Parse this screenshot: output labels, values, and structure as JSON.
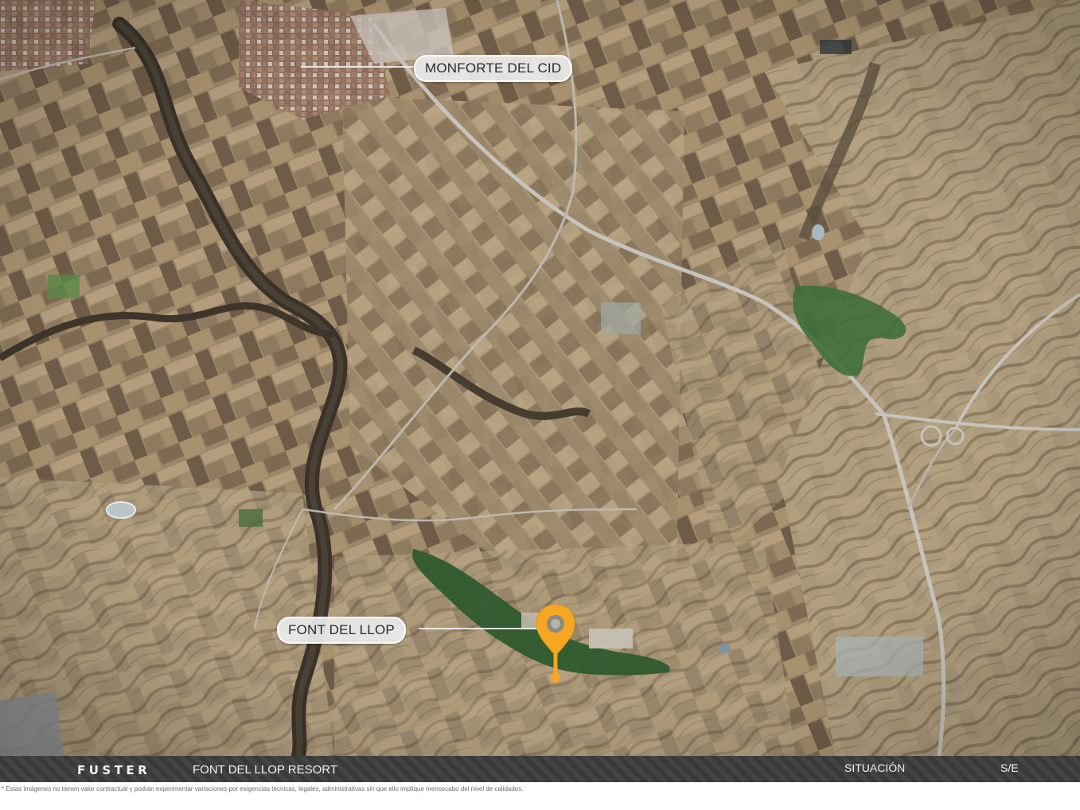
{
  "map": {
    "labels": {
      "monforte": "MONFORTE DEL CID",
      "font_del_llop": "FONT DEL LLOP"
    },
    "marker": {
      "icon": "location-pin-icon",
      "color": "#f5a623"
    }
  },
  "footer": {
    "brand": "FUSTER",
    "project": "FONT DEL LLOP RESORT",
    "section": "SITUACIÓN",
    "scale": "S/E"
  },
  "disclaimer": "* Estas imágenes no tienen valor contractual y podrán experimentar variaciones por exigencias técnicas, legales, administrativas sin que ello implique menoscabo del nivel de calidades.",
  "colors": {
    "footer_bg": "#3a3a38",
    "footer_text": "#f3f3f3",
    "marker": "#f5a623",
    "golf_green": "#3f6f3a"
  }
}
